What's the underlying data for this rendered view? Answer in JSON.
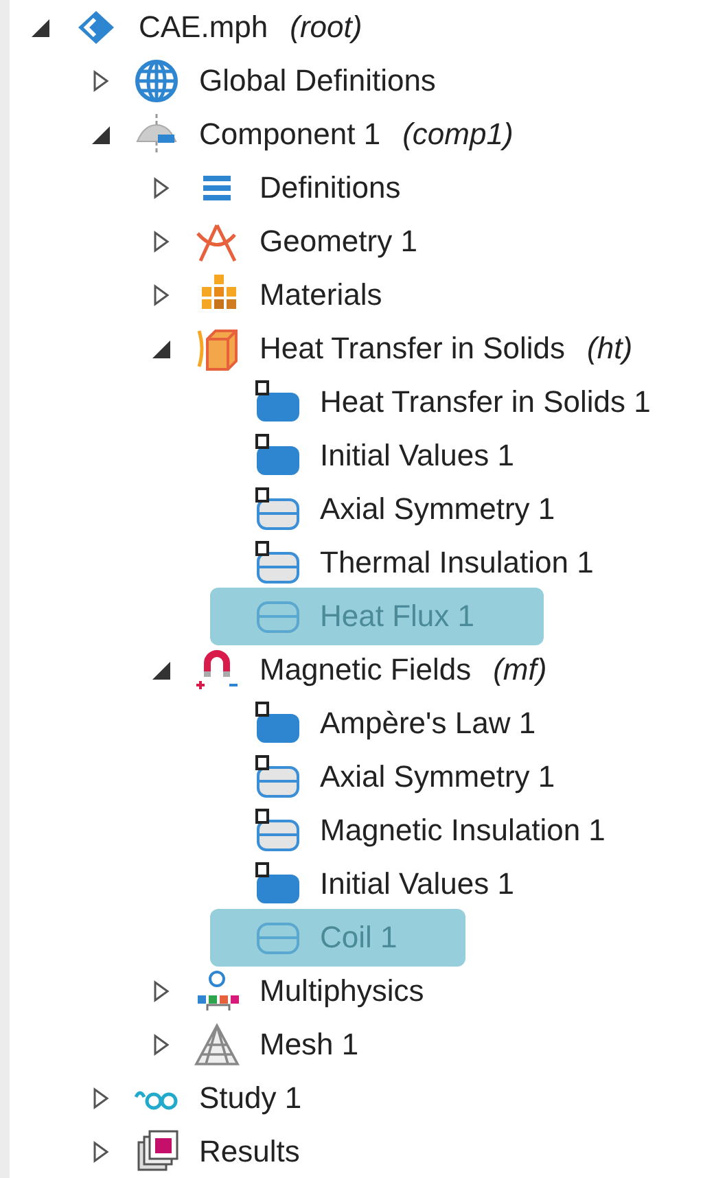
{
  "tree": [
    {
      "label": "CAE.mph",
      "tag": "(root)",
      "kind": "root",
      "expanded": true,
      "selected": false,
      "children": [
        {
          "label": "Global Definitions",
          "kind": "globe",
          "expanded": false,
          "selected": false
        },
        {
          "label": "Component 1",
          "tag": "(comp1)",
          "kind": "component",
          "expanded": true,
          "selected": false,
          "children": [
            {
              "label": "Definitions",
              "kind": "definitions",
              "expanded": false,
              "selected": false
            },
            {
              "label": "Geometry 1",
              "kind": "geometry",
              "expanded": false,
              "selected": false
            },
            {
              "label": "Materials",
              "kind": "materials",
              "expanded": false,
              "selected": false
            },
            {
              "label": "Heat Transfer in Solids",
              "tag": "(ht)",
              "kind": "heat",
              "expanded": true,
              "selected": false,
              "children": [
                {
                  "label": "Heat Transfer in Solids 1",
                  "kind": "domain-node",
                  "selected": false
                },
                {
                  "label": "Initial Values 1",
                  "kind": "domain-node",
                  "selected": false
                },
                {
                  "label": "Axial Symmetry 1",
                  "kind": "boundary-default-node",
                  "selected": false
                },
                {
                  "label": "Thermal Insulation 1",
                  "kind": "boundary-default-node",
                  "selected": false
                },
                {
                  "label": "Heat Flux 1",
                  "kind": "boundary-node",
                  "selected": true
                }
              ]
            },
            {
              "label": "Magnetic Fields",
              "tag": "(mf)",
              "kind": "magnet",
              "expanded": true,
              "selected": false,
              "children": [
                {
                  "label": "Ampère's Law 1",
                  "kind": "domain-node",
                  "selected": false
                },
                {
                  "label": "Axial Symmetry 1",
                  "kind": "boundary-default-node",
                  "selected": false
                },
                {
                  "label": "Magnetic Insulation 1",
                  "kind": "boundary-default-node",
                  "selected": false
                },
                {
                  "label": "Initial Values 1",
                  "kind": "domain-node",
                  "selected": false
                },
                {
                  "label": "Coil 1",
                  "kind": "boundary-node",
                  "selected": true
                }
              ]
            },
            {
              "label": "Multiphysics",
              "kind": "multiphysics",
              "expanded": false,
              "selected": false
            },
            {
              "label": "Mesh 1",
              "kind": "mesh",
              "expanded": false,
              "selected": false
            }
          ]
        },
        {
          "label": "Study 1",
          "kind": "study",
          "expanded": false,
          "selected": false
        },
        {
          "label": "Results",
          "kind": "results",
          "expanded": false,
          "selected": false
        }
      ]
    }
  ]
}
